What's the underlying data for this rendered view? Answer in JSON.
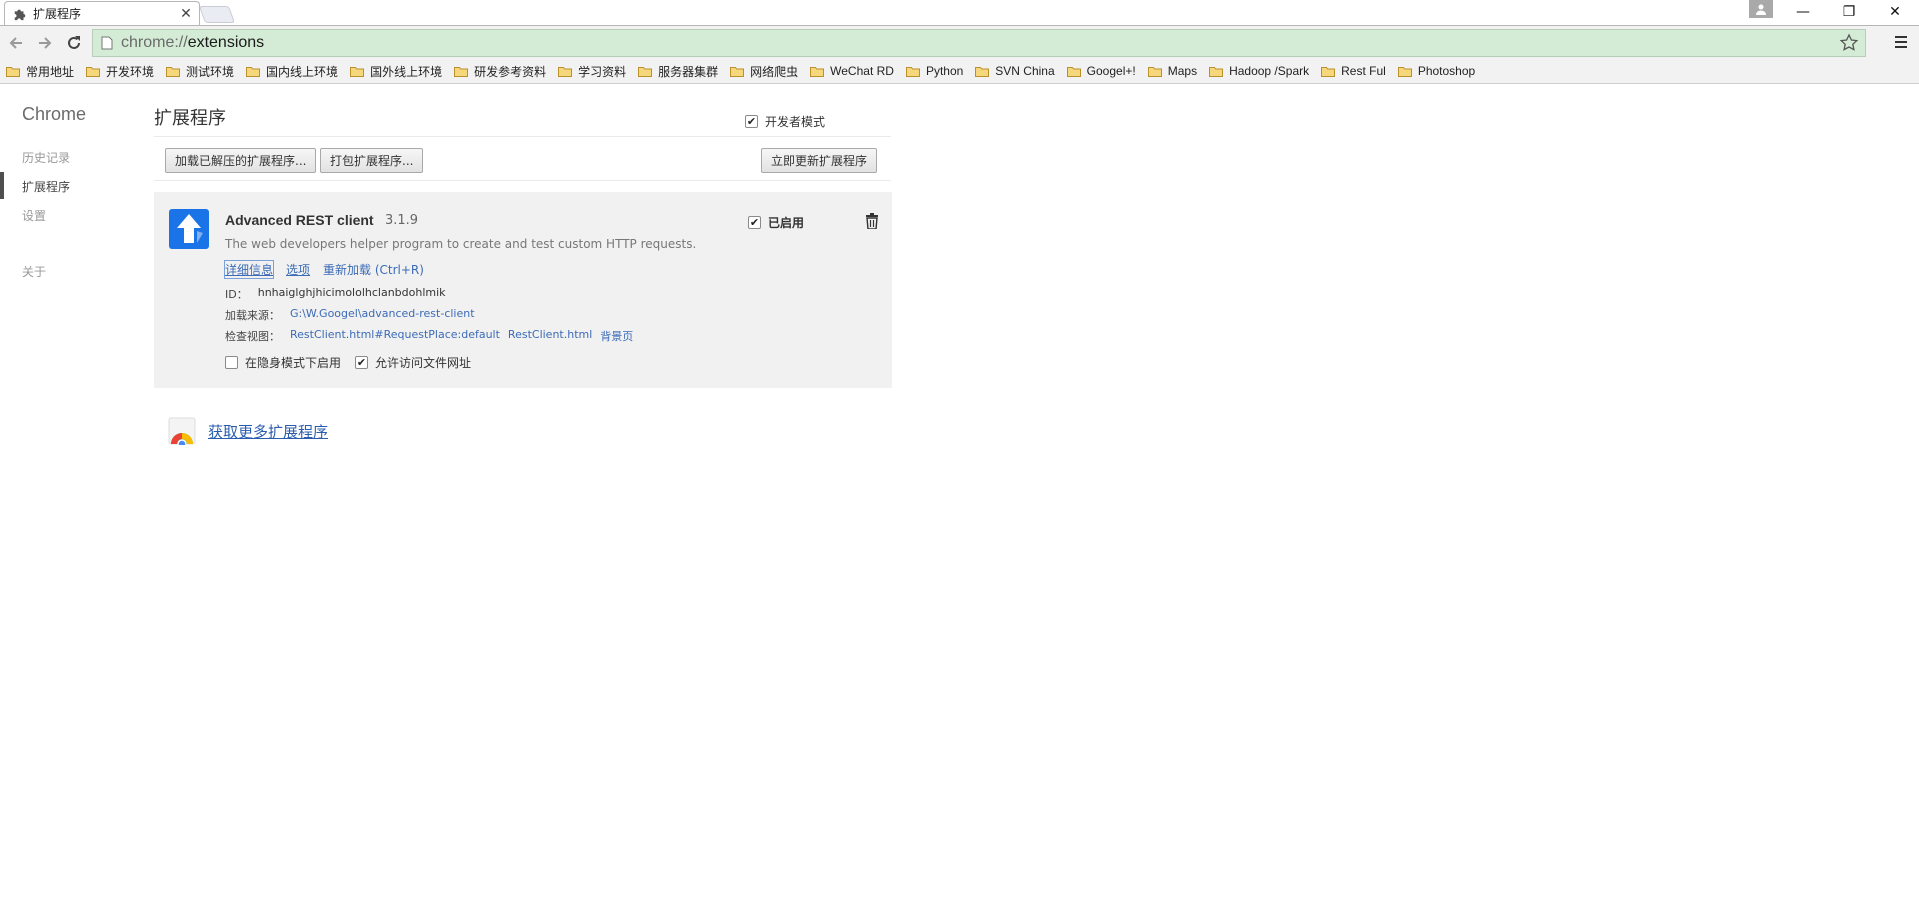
{
  "tab": {
    "title": "扩展程序",
    "close": "✕"
  },
  "window": {
    "minimize": "—",
    "restore": "❐",
    "close": "✕"
  },
  "omnibox": {
    "scheme": "chrome://",
    "path": "extensions"
  },
  "bookmarks": [
    "常用地址",
    "开发环境",
    "测试环境",
    "国内线上环境",
    "国外线上环境",
    "研发参考资料",
    "学习资料",
    "服务器集群",
    "网络爬虫",
    "WeChat RD",
    "Python",
    "SVN China",
    "Googel+!",
    "Maps",
    "Hadoop /Spark",
    "Rest Ful",
    "Photoshop"
  ],
  "sidebar": {
    "title": "Chrome",
    "items": [
      {
        "label": "历史记录"
      },
      {
        "label": "扩展程序"
      },
      {
        "label": "设置"
      },
      {
        "label": "关于"
      }
    ]
  },
  "main": {
    "title": "扩展程序",
    "developer_mode": {
      "label": "开发者模式",
      "checked": true
    },
    "buttons": {
      "load_unpacked": "加载已解压的扩展程序...",
      "pack": "打包扩展程序...",
      "update": "立即更新扩展程序"
    },
    "extension": {
      "name": "Advanced REST client",
      "version": "3.1.9",
      "description": "The web developers helper program to create and test custom HTTP requests.",
      "links": {
        "details": "详细信息",
        "options": "选项",
        "reload": "重新加载 (Ctrl+R)"
      },
      "id_label": "ID：",
      "id_value": "hnhaiglghjhicimololhclanbdohlmik",
      "source_label": "加载来源：",
      "source_value": "G:\\W.Googel\\advanced-rest-client",
      "inspect_label": "检查视图：",
      "inspect_views": [
        "RestClient.html#RequestPlace:default",
        "RestClient.html",
        "背景页"
      ],
      "incognito": {
        "label": "在隐身模式下启用",
        "checked": false
      },
      "file_access": {
        "label": "允许访问文件网址",
        "checked": true
      },
      "enabled": {
        "label": "已启用",
        "checked": true
      }
    },
    "get_more": "获取更多扩展程序"
  }
}
